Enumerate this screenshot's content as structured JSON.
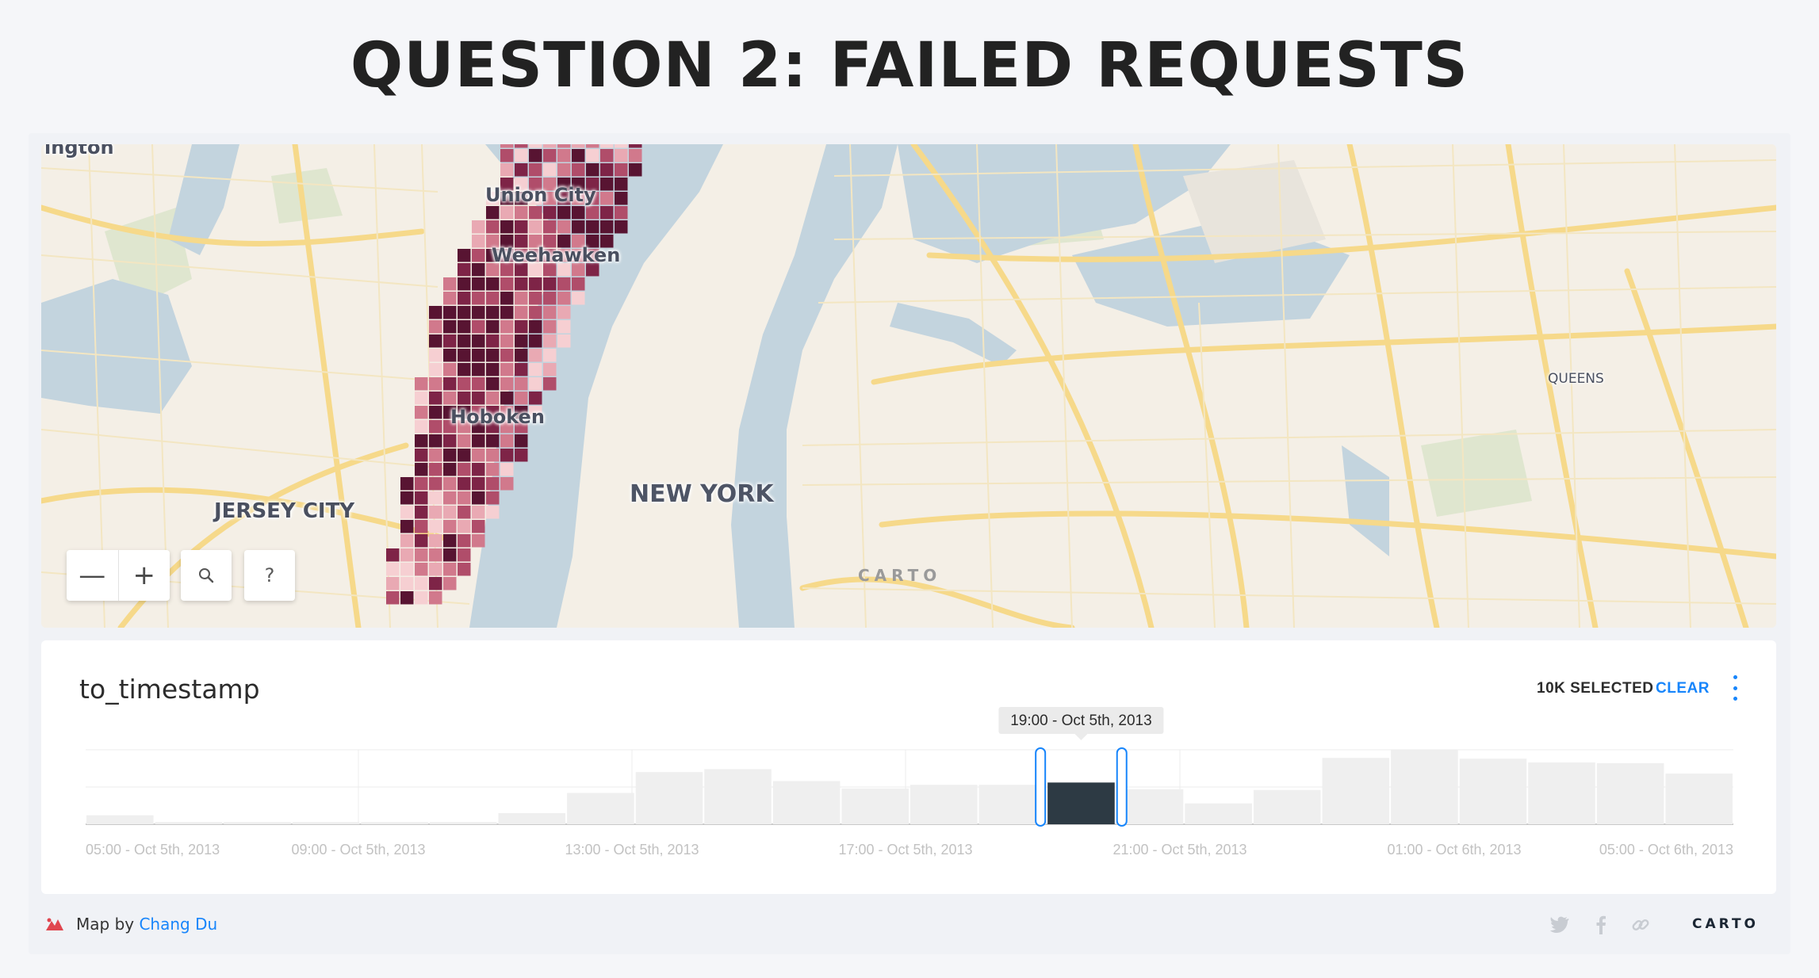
{
  "page_title": "QUESTION 2: FAILED REQUESTS",
  "map": {
    "labels": {
      "corner": "ington",
      "union_city": "Union City",
      "weehawken": "Weehawken",
      "hoboken": "Hoboken",
      "jersey_city": "JERSEY CITY",
      "new_york": "NEW YORK",
      "queens": "QUEENS"
    },
    "watermark": "CARTO",
    "controls": {
      "zoom_out": "—",
      "zoom_in": "+",
      "search_icon": "search-icon",
      "help": "?"
    },
    "colors": {
      "land": "#f4efe6",
      "water": "#c3d4de",
      "roads": "#f6d98a",
      "park": "#dfe6cf",
      "cell_scale": [
        "#f6cfd2",
        "#e9a9b3",
        "#d1798c",
        "#b04d6a",
        "#7e2447",
        "#581432"
      ]
    }
  },
  "widget": {
    "title": "to_timestamp",
    "selected": "10K SELECTED",
    "clear": "CLEAR",
    "tooltip": "19:00 - Oct 5th, 2013",
    "accent": "#1785fb",
    "selected_bar_color": "#2d3a44"
  },
  "chart_data": {
    "type": "bar",
    "title": "to_timestamp",
    "x_tick_labels": [
      "05:00 - Oct 5th, 2013",
      "09:00 - Oct 5th, 2013",
      "13:00 - Oct 5th, 2013",
      "17:00 - Oct 5th, 2013",
      "21:00 - Oct 5th, 2013",
      "01:00 - Oct 6th, 2013",
      "05:00 - Oct 6th, 2013"
    ],
    "bins_relative_height": [
      0.12,
      0.03,
      0.03,
      0.03,
      0.03,
      0.03,
      0.15,
      0.42,
      0.7,
      0.74,
      0.58,
      0.48,
      0.53,
      0.53,
      0.56,
      0.47,
      0.28,
      0.46,
      0.89,
      1.0,
      0.88,
      0.83,
      0.82,
      0.68
    ],
    "selected_bin_index": 14,
    "grid": true
  },
  "footer": {
    "credit_prefix": "Map by",
    "author": "Chang Du",
    "icons": [
      "twitter-icon",
      "facebook-icon",
      "link-icon"
    ],
    "logo": "CARTO"
  }
}
